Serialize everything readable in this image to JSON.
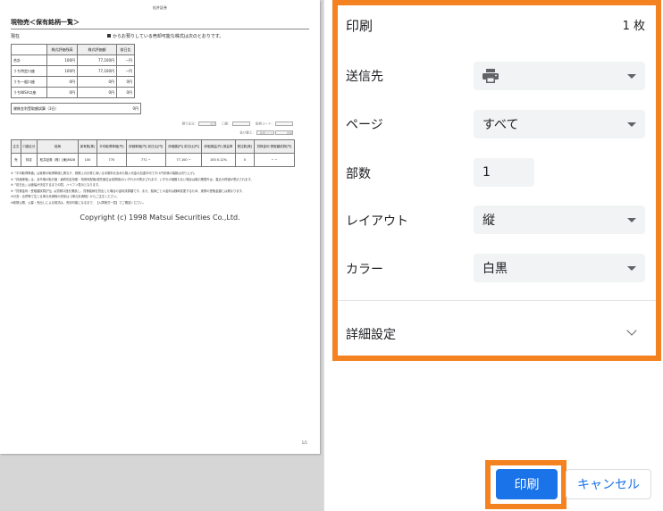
{
  "colors": {
    "accent": "#1a73e8",
    "highlight": "#f58220"
  },
  "preview": {
    "header": "松井証券",
    "title": "現物売＜保有銘柄一覧＞",
    "as_of": "現在",
    "intro": "からお預りしている売却可能な株式は次のとおりです。",
    "summary": {
      "headers": [
        "株式評価残高",
        "株式評価額",
        "前日比"
      ],
      "rows": [
        [
          "合計",
          "100円",
          "77,100円",
          "−円"
        ],
        [
          "うち特定口座",
          "100円",
          "77,100円",
          "−円"
        ],
        [
          "うち一般口座",
          "0円",
          "0円",
          "0円"
        ],
        [
          "うちNISA口座",
          "0円",
          "0円",
          "0円"
        ]
      ]
    },
    "shares_label": "貸株金利受取額試算（3日）",
    "shares_value": "0円",
    "filters": {
      "account_label": "預り区分：",
      "account_value": "表示",
      "port_label": "口座：",
      "code_label": "銘柄コード：",
      "sort_label": "並び替え：",
      "sort_value": "銘柄コード",
      "order_value": "昇順"
    },
    "holdings": {
      "headers": [
        "注文",
        "口座区分",
        "銘柄",
        "保有数[株]",
        "平均取得単価[円]",
        "評価単価[円] 前日比[円]",
        "評価額[円] 前日比[円]",
        "評価損益[円] 損益率",
        "発注数[株]",
        "貸株金利 受取額試算[円]"
      ],
      "row": [
        "売",
        "特定",
        "松井証券（株）[東]8628",
        "100",
        "770",
        "771 −",
        "77,100 −",
        "100 0.12%",
        "0",
        "− −"
      ]
    },
    "notes": [
      "※「平均取得単価」は実際の取得単価と異なり、税務上の計算に用いる手数料を含めた購入代金の加重平均です(1円未満の端数は切り上げ)。",
      "※「評価単価」は、全市場の取引値・最終約定気配・特例気配値(優先順位は前掲順)のいずれかが表示されます。いずれの価格もない場合は取引期間外は、直近の終値が表示されます。",
      "※「前日比」は値幅が決定するまでの間、ハイフン表示となります。",
      "※「貸株金利・受取額試算[円]」は貸株口座を開設し、貸株銘柄を貸出した場合の金利試算額です。また、銘柄ごとの金利は随時変更するため、実際の受取金額とは異なります。",
      "※分割・合併等で生じる単元未満株の売却は【単元未満株】からご注文ください。",
      "※新規公開、公募・売出しによる株式は、売却可能になるまで、【入庫株式一覧】でご確認ください。"
    ],
    "copyright": "Copyright (c) 1998 Matsui Securities Co.,Ltd.",
    "page_number": "1/1"
  },
  "settings": {
    "title": "印刷",
    "sheets": "1 枚",
    "destination_label": "送信先",
    "destination_icon": "printer-icon",
    "pages_label": "ページ",
    "pages_value": "すべて",
    "copies_label": "部数",
    "copies_value": "1",
    "layout_label": "レイアウト",
    "layout_value": "縦",
    "color_label": "カラー",
    "color_value": "白黒",
    "more_label": "詳細設定"
  },
  "buttons": {
    "print": "印刷",
    "cancel": "キャンセル"
  }
}
